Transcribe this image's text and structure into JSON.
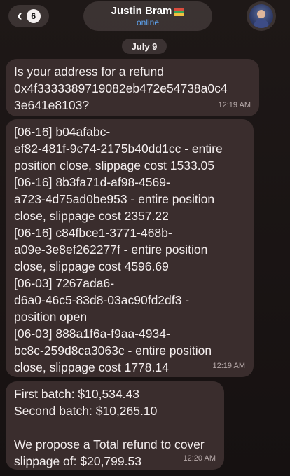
{
  "header": {
    "back_badge": "6",
    "contact_name": "Justin Bram",
    "status": "online"
  },
  "date_label": "July 9",
  "messages": [
    {
      "text": "Is your address for a refund\n0x4f3333389719082eb472e54738a0c4\n3e641e8103?",
      "time": "12:19 AM"
    },
    {
      "text": "[06-16] b04afabc-\nef82-481f-9c74-2175b40dd1cc - entire\nposition close, slippage cost 1533.05\n[06-16] 8b3fa71d-af98-4569-\na723-4d75ad0be953 - entire position\nclose, slippage cost 2357.22\n[06-16] c84fbce1-3771-468b-\na09e-3e8ef262277f - entire position\nclose, slippage cost 4596.69\n[06-03] 7267ada6-\nd6a0-46c5-83d8-03ac90fd2df3 -\nposition open\n[06-03] 888a1f6a-f9aa-4934-\nbc8c-259d8ca3063c - entire position\nclose, slippage cost 1778.14",
      "time": "12:19 AM"
    },
    {
      "text": "First batch: $10,534.43\nSecond batch: $10,265.10\n\nWe propose a Total refund to cover\nslippage of: $20,799.53",
      "time": "12:20 AM"
    }
  ]
}
